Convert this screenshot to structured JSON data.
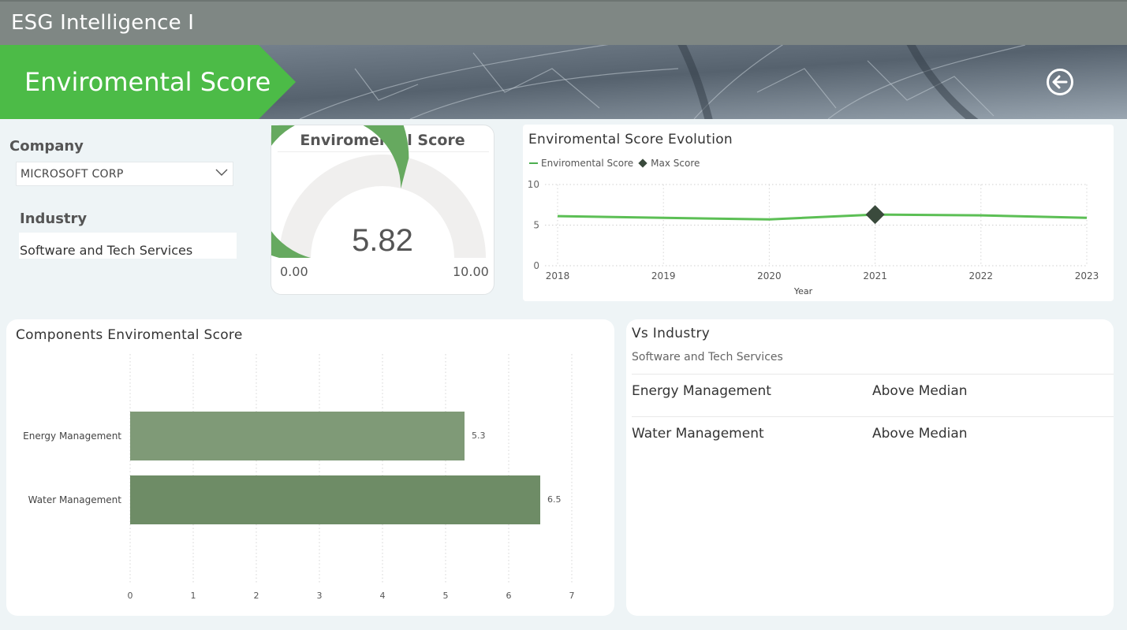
{
  "app": {
    "title": "ESG Intelligence I"
  },
  "banner": {
    "title": "Enviromental Score",
    "back_icon": "arrow-left-circle-icon"
  },
  "filters": {
    "company_label": "Company",
    "company_value": "MICROSOFT CORP",
    "industry_label": "Industry",
    "industry_value": "Software and Tech Services"
  },
  "colors": {
    "accent_green": "#4cbb47",
    "gauge_fill": "#66a95f",
    "gauge_track": "#f0efee",
    "line": "#5cbf55",
    "marker": "#3a4a3c",
    "bar_energy": "#7f9a77",
    "bar_water": "#6e8c66"
  },
  "gauge": {
    "title": "Enviromental Score",
    "value": 5.82,
    "value_text": "5.82",
    "min": 0,
    "max": 10,
    "min_text": "0.00",
    "max_text": "10.00"
  },
  "evolution": {
    "title": "Enviromental Score Evolution",
    "legend_score": "Enviromental Score",
    "legend_max": "Max Score"
  },
  "components": {
    "title": "Components Enviromental Score"
  },
  "vs_industry": {
    "title": "Vs Industry",
    "subtitle": "Software and Tech Services",
    "rows": [
      {
        "name": "Energy Management",
        "status": "Above Median"
      },
      {
        "name": "Water Management",
        "status": "Above Median"
      }
    ]
  },
  "chart_data": [
    {
      "type": "line",
      "title": "Enviromental Score Evolution",
      "x": [
        "2018",
        "2019",
        "2020",
        "2021",
        "2022",
        "2023"
      ],
      "series": [
        {
          "name": "Enviromental Score",
          "values": [
            6.1,
            5.9,
            5.7,
            6.3,
            6.2,
            5.9
          ]
        }
      ],
      "max_marker": {
        "name": "Max Score",
        "x": "2021",
        "y": 6.3
      },
      "xlabel": "Year",
      "ylabel": "",
      "ylim": [
        0,
        10
      ],
      "yticks": [
        0,
        5,
        10
      ],
      "grid": true,
      "legend": "top-left"
    },
    {
      "type": "bar",
      "orientation": "horizontal",
      "title": "Components Enviromental Score",
      "categories": [
        "Energy Management",
        "Water Management"
      ],
      "values": [
        5.3,
        6.5
      ],
      "value_labels": [
        "5.3",
        "6.5"
      ],
      "xlim": [
        0,
        7
      ],
      "xticks": [
        0,
        1,
        2,
        3,
        4,
        5,
        6,
        7
      ],
      "grid": true
    }
  ]
}
